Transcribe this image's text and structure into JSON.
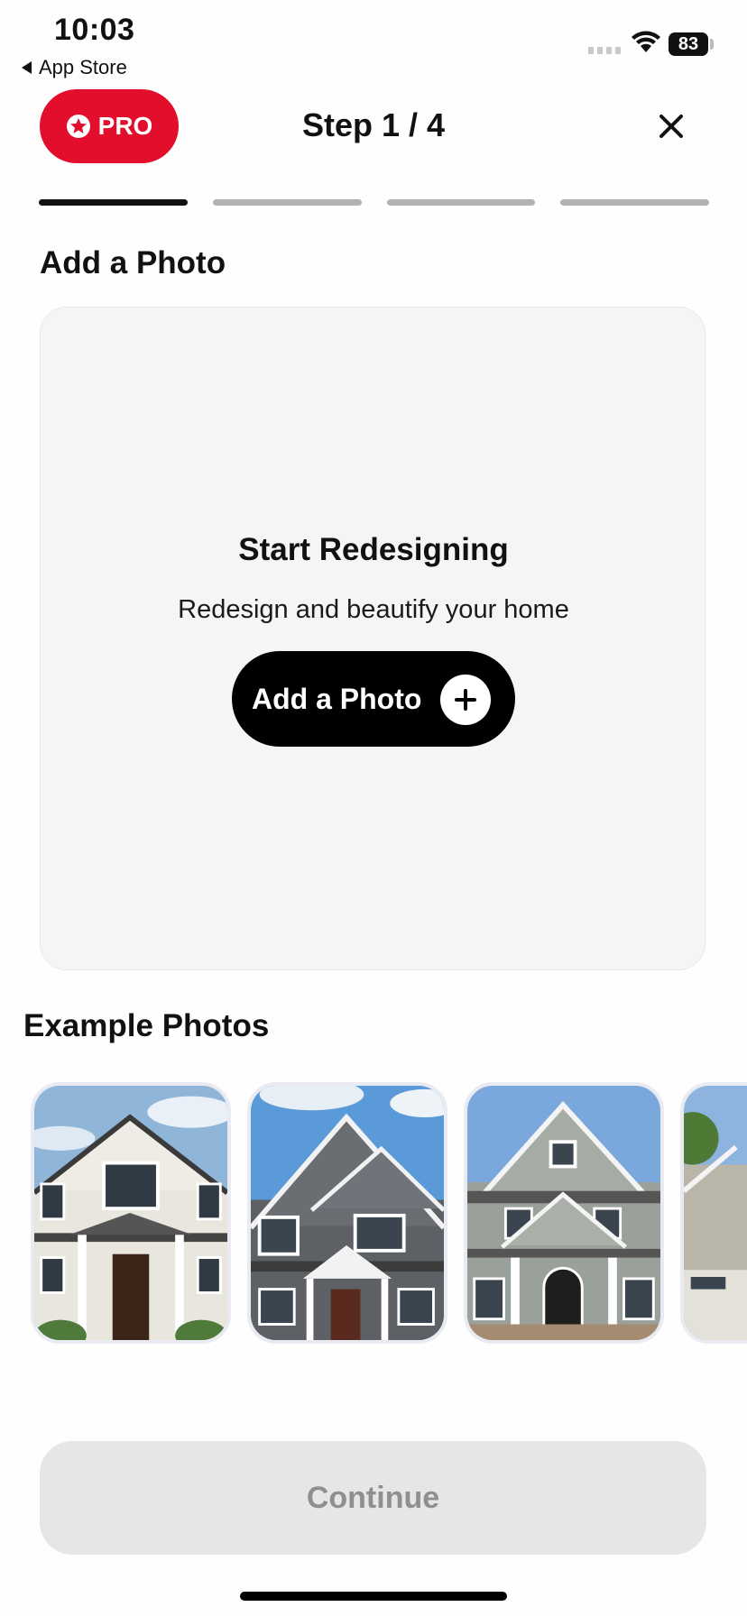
{
  "status_bar": {
    "time": "10:03",
    "back_app": "App Store",
    "battery": "83"
  },
  "header": {
    "pro_label": "PRO",
    "step_title": "Step 1 / 4",
    "close_icon": "close-icon"
  },
  "progress": {
    "current_step": 1,
    "total_steps": 4
  },
  "add_photo_section": {
    "title": "Add a Photo",
    "card_heading": "Start Redesigning",
    "card_subtitle": "Redesign and beautify your home",
    "button_label": "Add a Photo",
    "button_icon": "plus-circle-icon"
  },
  "examples": {
    "title": "Example Photos",
    "photos": [
      {
        "name": "white-colonial-house"
      },
      {
        "name": "gray-shingle-house"
      },
      {
        "name": "gray-craftsman-house"
      },
      {
        "name": "beige-garage-house"
      }
    ]
  },
  "footer": {
    "continue_label": "Continue"
  },
  "colors": {
    "pro_red": "#e30d2c",
    "primary_black": "#000000",
    "disabled_gray": "#e6e6e6"
  }
}
